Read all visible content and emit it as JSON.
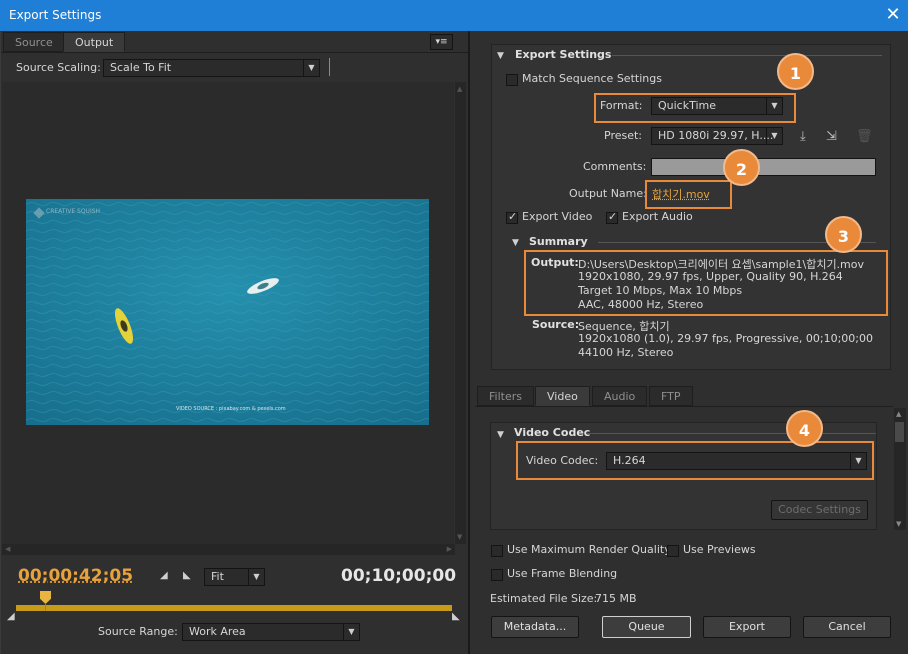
{
  "window": {
    "title": "Export Settings",
    "close_glyph": "✕"
  },
  "left": {
    "tabs": [
      {
        "label": "Source"
      },
      {
        "label": "Output"
      }
    ],
    "menu_glyph": "▾≡",
    "source_scaling_label": "Source Scaling:",
    "source_scaling_value": "Scale To Fit",
    "video_watermark": "CREATIVE SQUISH",
    "video_source_text": "VIDEO SOURCE : pixabay.com & pexels.com",
    "timecode_current": "00;00;42;05",
    "timecode_end": "00;10;00;00",
    "zoom_value": "Fit",
    "source_range_label": "Source Range:",
    "source_range_value": "Work Area"
  },
  "export_settings": {
    "section_title": "Export Settings",
    "match_sequence_label": "Match Sequence Settings",
    "format_label": "Format:",
    "format_value": "QuickTime",
    "preset_label": "Preset:",
    "preset_value": "HD 1080i 29.97, H....",
    "comments_label": "Comments:",
    "comments_value": "",
    "output_name_label": "Output Name:",
    "output_name_value": "합치기.mov",
    "export_video_label": "Export Video",
    "export_audio_label": "Export Audio",
    "summary_title": "Summary",
    "output_label": "Output:",
    "output_lines": [
      "D:\\Users\\Desktop\\크리에이터 요셉\\sample1\\합치기.mov",
      "1920x1080, 29.97 fps, Upper, Quality 90, H.264",
      "Target 10 Mbps, Max 10 Mbps",
      "AAC, 48000 Hz, Stereo"
    ],
    "source_label": "Source:",
    "source_lines": [
      "Sequence, 합치기",
      "1920x1080 (1.0), 29.97 fps, Progressive, 00;10;00;00",
      "44100 Hz, Stereo"
    ]
  },
  "tabs2": [
    {
      "label": "Filters"
    },
    {
      "label": "Video"
    },
    {
      "label": "Audio"
    },
    {
      "label": "FTP"
    }
  ],
  "video_codec": {
    "section_title": "Video Codec",
    "label": "Video Codec:",
    "value": "H.264",
    "codec_settings_label": "Codec Settings"
  },
  "bottom": {
    "max_render_label": "Use Maximum Render Quality",
    "use_previews_label": "Use Previews",
    "frame_blending_label": "Use Frame Blending",
    "file_size_label": "Estimated File Size:",
    "file_size_value": "715 MB",
    "metadata_label": "Metadata...",
    "queue_label": "Queue",
    "export_label": "Export",
    "cancel_label": "Cancel"
  },
  "badges": [
    "1",
    "2",
    "3",
    "4"
  ],
  "colors": {
    "accent": "#e98a3a",
    "titlebar": "#1f7fd6",
    "timecode": "#e8a23c"
  }
}
